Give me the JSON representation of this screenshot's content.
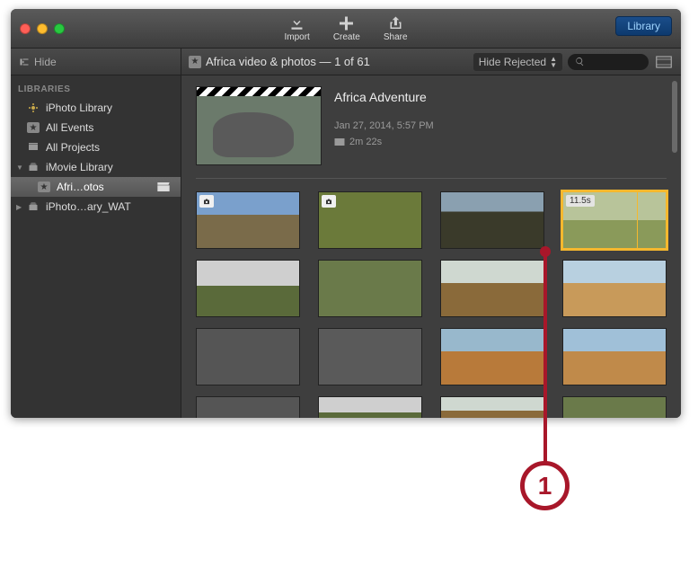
{
  "toolbar": {
    "import_label": "Import",
    "create_label": "Create",
    "share_label": "Share",
    "library_label": "Library",
    "hide_label": "Hide"
  },
  "content_header": {
    "path": "Africa video & photos — 1 of 61",
    "hide_rejected": "Hide Rejected"
  },
  "sidebar": {
    "section": "LIBRARIES",
    "items": [
      {
        "label": "iPhoto Library"
      },
      {
        "label": "All Events"
      },
      {
        "label": "All Projects"
      },
      {
        "label": "iMovie Library"
      },
      {
        "label": "Afri…otos"
      },
      {
        "label": "iPhoto…ary_WAT"
      }
    ]
  },
  "event": {
    "title": "Africa Adventure",
    "date": "Jan 27, 2014, 5:57 PM",
    "duration": "2m 22s"
  },
  "selected_clip": {
    "time": "11.5s"
  },
  "annotation": {
    "number": "1"
  }
}
